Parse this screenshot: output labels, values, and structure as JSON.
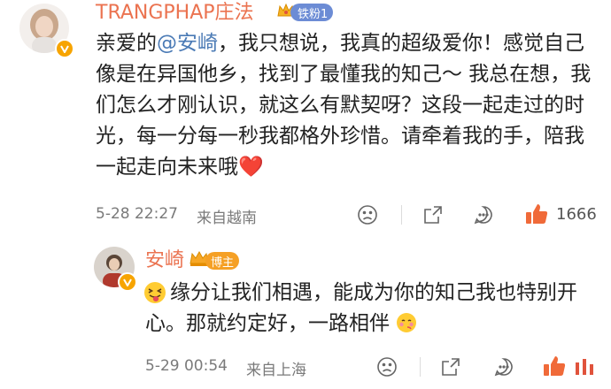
{
  "comment": {
    "username": "TRANGPHAP庄法",
    "fan_badge": "铁粉1",
    "text_pre": "亲爱的",
    "mention": "@安崎",
    "text_post": "，我只想说，我真的超级爱你！感觉自己像是在异国他乡，找到了最懂我的知己～ 我总在想，我们怎么才刚认识，就这么有默契呀？这段一起走过的时光，每一分每一秒我都格外珍惜。请牵着我的手，陪我一起走向未来哦",
    "heart_emoji": "❤️",
    "timestamp": "5-28 22:27",
    "source": "来自越南",
    "like_count": "1666"
  },
  "reply": {
    "username": "安崎",
    "role_badge": "博主",
    "text": "缘分让我们相遇，能成为你的知己我也特别开心。那就约定好，一路相伴",
    "timestamp": "5-29 00:54",
    "source": "来自上海"
  },
  "colors": {
    "username": "#eb7350",
    "mention": "#4a7ab5",
    "like_active": "#f06a39",
    "verified": "#f7a400"
  },
  "icons": [
    "sad-face-icon",
    "share-icon",
    "comment-icon",
    "thumbs-up-icon",
    "crown-icon",
    "tongue-emoji-icon",
    "blush-emoji-icon"
  ]
}
